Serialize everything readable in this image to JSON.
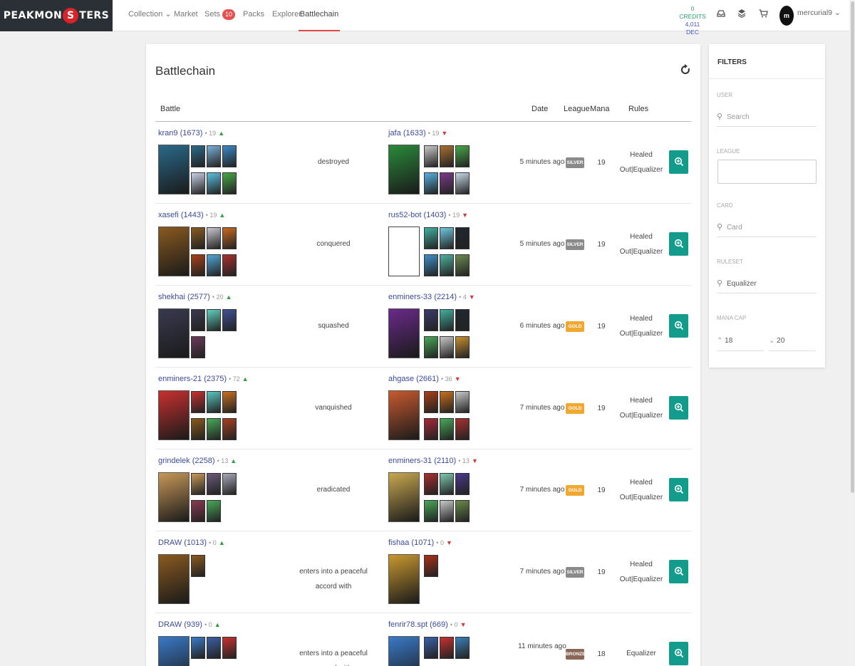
{
  "nav": {
    "logo": {
      "left": "PEAKMON",
      "o": "S",
      "right": "TERS"
    },
    "collection": "Collection",
    "market": "Market",
    "sets": "Sets",
    "sets_badge": "10",
    "packs": "Packs",
    "explorer": "Explorer",
    "battlechain": "Battlechain",
    "credits_line1": "0 CREDITS",
    "credits_line2": "4,011 DEC",
    "username": "mercurial9",
    "avatar_text": "m"
  },
  "page": {
    "title": "Battlechain",
    "col_battle": "Battle",
    "col_date": "Date",
    "col_league": "League",
    "col_mana": "Mana",
    "col_rules": "Rules"
  },
  "battles": [
    {
      "p1": "kran9",
      "p1r": "(1673)",
      "p1l": "19",
      "p2": "jafa",
      "p2r": "(1633)",
      "p2l": "19",
      "result": "destroyed",
      "date": "5 minutes ago",
      "league": "SILVER",
      "mana": "19",
      "rules": "Healed Out|Equalizer"
    },
    {
      "p1": "xasefi",
      "p1r": "(1443)",
      "p1l": "19",
      "p2": "rus52-bot",
      "p2r": "(1403)",
      "p2l": "19",
      "result": "conquered",
      "date": "5 minutes ago",
      "league": "SILVER",
      "mana": "19",
      "rules": "Healed Out|Equalizer"
    },
    {
      "p1": "shekhai",
      "p1r": "(2577)",
      "p1l": "20",
      "p2": "enminers-33",
      "p2r": "(2214)",
      "p2l": "4",
      "result": "squashed",
      "date": "6 minutes ago",
      "league": "GOLD",
      "mana": "19",
      "rules": "Healed Out|Equalizer"
    },
    {
      "p1": "enminers-21",
      "p1r": "(2375)",
      "p1l": "72",
      "p2": "ahgase",
      "p2r": "(2661)",
      "p2l": "36",
      "result": "vanquished",
      "date": "7 minutes ago",
      "league": "GOLD",
      "mana": "19",
      "rules": "Healed Out|Equalizer"
    },
    {
      "p1": "grindelek",
      "p1r": "(2258)",
      "p1l": "13",
      "p2": "enminers-31",
      "p2r": "(2110)",
      "p2l": "13",
      "result": "eradicated",
      "date": "7 minutes ago",
      "league": "GOLD",
      "mana": "19",
      "rules": "Healed Out|Equalizer"
    },
    {
      "p1": "DRAW",
      "p1r": "(1013)",
      "p1l": "0",
      "p2": "fishaa",
      "p2r": "(1071)",
      "p2l": "0",
      "result": "enters into a peaceful accord with",
      "date": "7 minutes ago",
      "league": "SILVER",
      "mana": "19",
      "rules": "Healed Out|Equalizer"
    },
    {
      "p1": "DRAW",
      "p1r": "(939)",
      "p1l": "0",
      "p2": "fenrir78.spt",
      "p2r": "(669)",
      "p2l": "0",
      "result": "enters into a peaceful accord with",
      "date": "11 minutes ago",
      "league": "BRONZE",
      "mana": "18",
      "rules": "Equalizer"
    }
  ],
  "filters": {
    "title": "FILTERS",
    "user_label": "USER",
    "user_placeholder": "Search",
    "league_label": "LEAGUE",
    "card_label": "CARD",
    "card_placeholder": "Card",
    "ruleset_label": "RULESET",
    "ruleset_value": "Equalizer",
    "mana_label": "MANA CAP",
    "mana_min": "18",
    "mana_max": "20"
  },
  "colors": {
    "silver": "#8a8a8a",
    "gold": "#f0a830",
    "bronze": "#8a6656",
    "accent": "#139c8c",
    "link": "#3c4a9c"
  }
}
